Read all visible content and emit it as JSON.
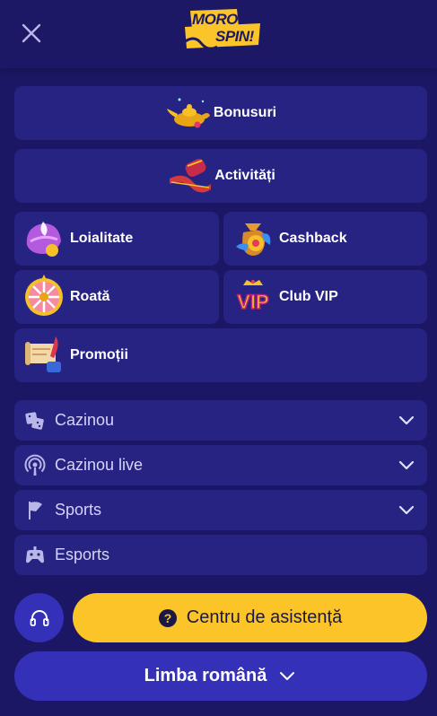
{
  "header": {
    "logo_line1": "MORO",
    "logo_line2": "SPIN!"
  },
  "features": {
    "bonuses": "Bonusuri",
    "activities": "Activități",
    "loyalty": "Loialitate",
    "cashback": "Cashback",
    "wheel": "Roată",
    "vip": "Club VIP",
    "promotions": "Promoții"
  },
  "vip_badge": "VIP",
  "menu": {
    "casino": "Cazinou",
    "live_casino": "Cazinou live",
    "sports": "Sports",
    "esports": "Esports"
  },
  "footer": {
    "help_label": "Centru de asistență",
    "help_icon_glyph": "?",
    "language_label": "Limba română"
  },
  "colors": {
    "background": "#1b1764",
    "card": "#272383",
    "accent_yellow": "#fbc52a",
    "button_blue": "#3430b8"
  }
}
